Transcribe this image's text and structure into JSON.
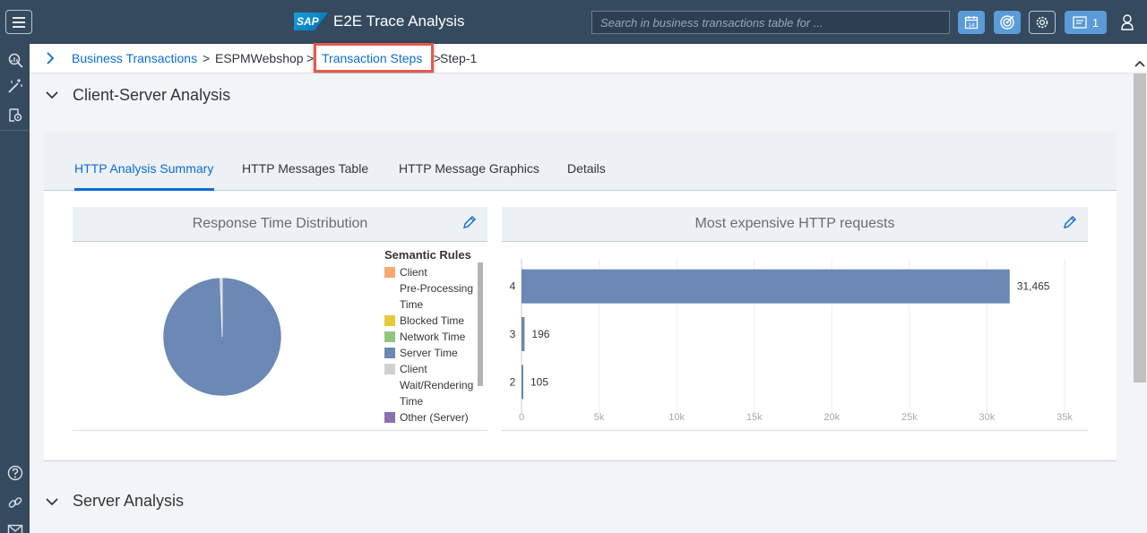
{
  "header": {
    "logo_text": "SAP",
    "title": "E2E Trace Analysis",
    "search_placeholder": "Search in business transactions table for ...",
    "calendar_day": "14",
    "notification_count": "1",
    "icons": [
      "menu-icon",
      "calendar-icon",
      "target-icon",
      "gear-icon",
      "notification-icon",
      "user-icon"
    ]
  },
  "left_rail": {
    "icons": [
      "analysis-icon",
      "magic-wand-icon",
      "inspect-icon",
      "help-icon",
      "link-icon",
      "mail-icon"
    ]
  },
  "breadcrumb": {
    "items": [
      "Business Transactions",
      "ESPMWebshop",
      "Transaction Steps",
      "Step-1"
    ],
    "separator": ">"
  },
  "sections": {
    "client_server": "Client-Server Analysis",
    "server": "Server Analysis"
  },
  "tabs": [
    "HTTP Analysis Summary",
    "HTTP Messages Table",
    "HTTP Message Graphics",
    "Details"
  ],
  "response_time_card": {
    "title": "Response Time Distribution",
    "legend_title": "Semantic Rules",
    "legend": [
      {
        "label": "Client",
        "color": "#f5a971"
      },
      {
        "label": "Pre-Processing",
        "color": ""
      },
      {
        "label": "Time",
        "color": ""
      },
      {
        "label": "Blocked Time",
        "color": "#e8c93d"
      },
      {
        "label": "Network Time",
        "color": "#93c47d"
      },
      {
        "label": "Server Time",
        "color": "#6c88b4"
      },
      {
        "label": "Client",
        "color": "#d0d0d0"
      },
      {
        "label": "Wait/Rendering",
        "color": ""
      },
      {
        "label": "Time",
        "color": ""
      },
      {
        "label": "Other (Server)",
        "color": "#8e6fad"
      }
    ]
  },
  "expensive_card": {
    "title": "Most expensive HTTP requests"
  },
  "chart_data": [
    {
      "type": "pie",
      "title": "Response Time Distribution",
      "slices": [
        {
          "name": "Server Time",
          "share": 0.994,
          "color": "#6c88b4"
        },
        {
          "name": "Client Wait/Rendering Time",
          "share": 0.006,
          "color": "#d0d0d0"
        }
      ]
    },
    {
      "type": "bar",
      "orientation": "horizontal",
      "title": "Most expensive HTTP requests",
      "categories": [
        "4",
        "3",
        "2"
      ],
      "values": [
        31465,
        196,
        105
      ],
      "value_labels": [
        "31,465",
        "196",
        "105"
      ],
      "xlim": [
        0,
        35000
      ],
      "x_ticks": [
        "0",
        "5k",
        "10k",
        "15k",
        "20k",
        "25k",
        "30k",
        "35k"
      ],
      "grid": true,
      "bar_color": "#6c88b4"
    }
  ]
}
